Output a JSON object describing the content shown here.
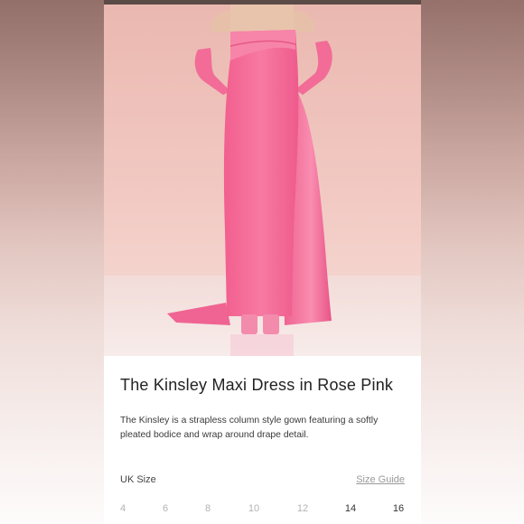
{
  "product": {
    "title": "The Kinsley Maxi Dress in Rose Pink",
    "description": "The Kinsley is a strapless column style gown featuring a softly pleated bodice and wrap around drape detail."
  },
  "size_selector": {
    "label": "UK Size",
    "guide_label": "Size Guide",
    "options": [
      {
        "label": "4",
        "available": false
      },
      {
        "label": "6",
        "available": false
      },
      {
        "label": "8",
        "available": false
      },
      {
        "label": "10",
        "available": false
      },
      {
        "label": "12",
        "available": false
      },
      {
        "label": "14",
        "available": true
      },
      {
        "label": "16",
        "available": true
      }
    ]
  },
  "colors": {
    "dress": "#f46f9a",
    "backdrop": "#f0c3bb",
    "floor": "#f3e3e1"
  }
}
